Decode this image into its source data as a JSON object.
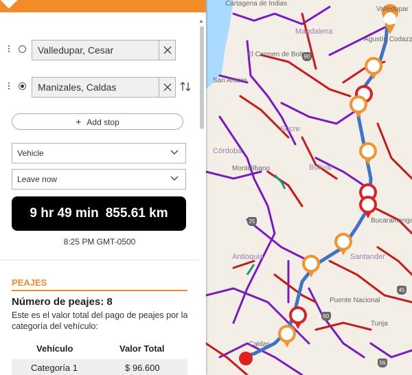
{
  "stops": [
    {
      "value": "Valledupar, Cesar"
    },
    {
      "value": "Manizales, Caldas"
    }
  ],
  "add_stop_label": "Add stop",
  "vehicle_select": "Vehicle",
  "time_select": "Leave now",
  "summary": {
    "duration": "9 hr 49 min",
    "distance": "855.61 km"
  },
  "arrival_time": "8:25 PM GMT-0500",
  "tolls": {
    "heading": "PEAJES",
    "count_text": "Número de peajes: 8",
    "description": "Este es el valor total del pago de peajes por la categoría del vehículo:",
    "table": {
      "headers": [
        "Vehículo",
        "Valor Total"
      ],
      "rows": [
        [
          "Categoría 1",
          "$ 96.600"
        ]
      ]
    }
  },
  "colors": {
    "accent": "#f28c28",
    "toll_orange": "#f5922b",
    "toll_red": "#e02020",
    "road_red": "#c81818",
    "road_purple": "#7a18c8",
    "route_blue": "#3f73c9"
  },
  "map": {
    "labels": [
      "Cartagena de Indias",
      "Magdalena",
      "Agustín Codazzi",
      "El Carmen de Bolívar",
      "San Antero",
      "Sucre",
      "Córdoba",
      "Montelíbano",
      "Bolívar",
      "Antioquia",
      "Santander",
      "Bucaramanga",
      "Puente Nacional",
      "Caldas",
      "Tunja",
      "Valledupar"
    ],
    "shields": [
      "90",
      "25",
      "45",
      "60",
      "56"
    ]
  }
}
